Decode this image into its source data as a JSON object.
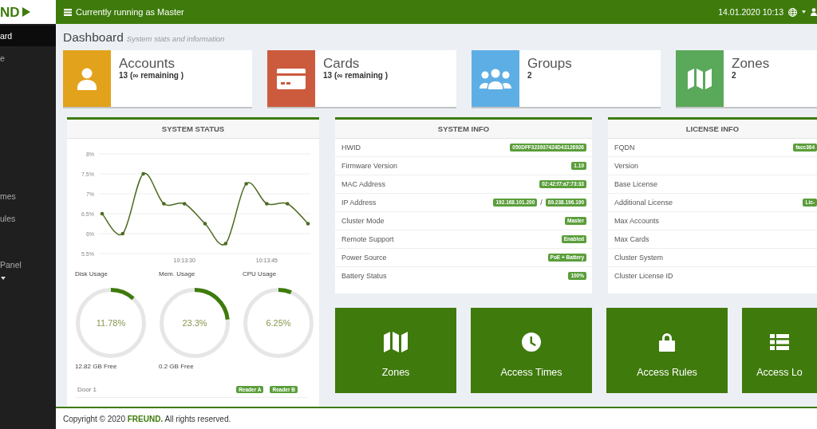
{
  "header": {
    "logo": "ND",
    "status": "Currently running as Master",
    "datetime": "14.01.2020 10:13"
  },
  "sidebar": {
    "sections": [
      {
        "items": [
          {
            "label": "ard",
            "selected": true
          },
          {
            "label": "e",
            "selected": false
          }
        ]
      },
      {
        "items": [
          {
            "label": "mes",
            "selected": false
          },
          {
            "label": "ules",
            "selected": false
          }
        ]
      },
      {
        "items": [
          {
            "label": "Panel",
            "selected": false
          }
        ],
        "expandable": true
      }
    ]
  },
  "page": {
    "title": "Dashboard",
    "subtitle": "System stats and information"
  },
  "stat_cards": [
    {
      "kind": "user",
      "title": "Accounts",
      "count": "13 (∞ remaining )",
      "color": "#e2a21c"
    },
    {
      "kind": "card",
      "title": "Cards",
      "count": "13 (∞ remaining )",
      "color": "#cc5a3d"
    },
    {
      "kind": "group",
      "title": "Groups",
      "count": "2",
      "color": "#5eaee6"
    },
    {
      "kind": "map",
      "title": "Zones",
      "count": "2",
      "color": "#5aa85a"
    }
  ],
  "system_status": {
    "title": "SYSTEM STATUS",
    "chart_data": {
      "type": "line",
      "grid": true,
      "categories": [
        null,
        null,
        null,
        null,
        "10:13:30",
        null,
        null,
        null,
        "10:13:45",
        null,
        null
      ],
      "series": [
        {
          "color": "#4d6b22",
          "values": [
            6.5,
            6,
            7.5,
            6.75,
            6.75,
            6.25,
            5.75,
            7.25,
            6.75,
            6.75,
            6.25
          ]
        }
      ],
      "ylim": [
        5.5,
        8
      ],
      "yticks": [
        {
          "value": 8,
          "label": "8%"
        },
        {
          "value": 7.5,
          "label": "7.5%"
        },
        {
          "value": 7,
          "label": "7%"
        },
        {
          "value": 6.5,
          "label": "6.5%"
        },
        {
          "value": 6,
          "label": "6%"
        },
        {
          "value": 5.5,
          "label": "5.5%"
        }
      ]
    },
    "gauges": [
      {
        "label": "Disk Usage",
        "reading": "11.78%",
        "level": 0.1178,
        "free": "12.82 GB Free"
      },
      {
        "label": "Mem. Usage",
        "reading": "23.3%",
        "level": 0.233,
        "free": "0.2 GB Free"
      },
      {
        "label": "CPU Usage",
        "reading": "6.25%",
        "level": 0.0625
      }
    ],
    "doors": [
      {
        "name": "Door 1",
        "readers": [
          "Reader A",
          "Reader B"
        ]
      }
    ]
  },
  "system_info": {
    "title": "SYSTEM INFO",
    "rows": [
      {
        "label": "HWID",
        "values": [
          "050DFF323937424D43126926"
        ]
      },
      {
        "label": "Firmware Version",
        "values": [
          "1.10"
        ]
      },
      {
        "label": "MAC Address",
        "values": [
          "02:42:f7:a7:73:33"
        ]
      },
      {
        "label": "IP Address",
        "values": [
          "192.168.101.200",
          "89.238.196.190"
        ],
        "separator": "/"
      },
      {
        "label": "Cluster Mode",
        "values": [
          "Master"
        ]
      },
      {
        "label": "Remote Support",
        "values": [
          "Enabled"
        ]
      },
      {
        "label": "Power Source",
        "values": [
          "PoE + Battery"
        ]
      },
      {
        "label": "Battery Status",
        "values": [
          "100%"
        ]
      }
    ]
  },
  "license_info": {
    "title": "LICENSE INFO",
    "rows": [
      {
        "label": "FQDN",
        "values": [
          "facc364"
        ]
      },
      {
        "label": "Version"
      },
      {
        "label": "Base License"
      },
      {
        "label": "Additional License",
        "values": [
          "Lic-"
        ]
      },
      {
        "label": "Max Accounts"
      },
      {
        "label": "Max Cards"
      },
      {
        "label": "Cluster System"
      },
      {
        "label": "Cluster License ID"
      }
    ]
  },
  "tiles": [
    {
      "kind": "map",
      "label": "Zones"
    },
    {
      "kind": "clock",
      "label": "Access Times"
    },
    {
      "kind": "lock",
      "label": "Access Rules"
    },
    {
      "kind": "list",
      "label": "Access Lo"
    }
  ],
  "footer": {
    "copyright": "Copyright © 2020 **FREUND.** All rights reserved."
  }
}
